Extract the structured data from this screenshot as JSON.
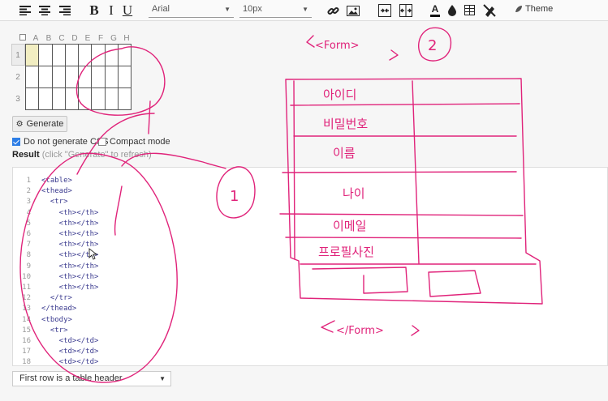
{
  "toolbar": {
    "font_family": "Arial",
    "font_size": "10px",
    "theme_label": "Theme",
    "icons": [
      "align-left-icon",
      "align-center-icon",
      "align-right-icon",
      "bold-icon",
      "italic-icon",
      "underline-icon",
      "link-icon",
      "image-icon",
      "merge-cells-icon",
      "split-cells-icon",
      "text-color-icon",
      "fill-color-icon",
      "table-border-icon",
      "clear-format-icon",
      "theme-icon"
    ],
    "bold_label": "B",
    "italic_label": "I",
    "underline_label": "U",
    "text_color_label": "A"
  },
  "grid": {
    "columns": [
      "A",
      "B",
      "C",
      "D",
      "E",
      "F",
      "G",
      "H"
    ],
    "rows": [
      "1",
      "2",
      "3"
    ],
    "highlight": "A1"
  },
  "actions": {
    "generate_label": "Generate",
    "no_css_label": "Do not generate CSS",
    "no_css_checked": true,
    "compact_label": "Compact mode",
    "compact_checked": false
  },
  "result": {
    "label": "Result",
    "note": "(click \"Generate\" to refresh)"
  },
  "code": {
    "lines": [
      "<table>",
      "<thead>",
      "  <tr>",
      "    <th></th>",
      "    <th></th>",
      "    <th></th>",
      "    <th></th>",
      "    <th></th>",
      "    <th></th>",
      "    <th></th>",
      "    <th></th>",
      "  </tr>",
      "</thead>",
      "<tbody>",
      "  <tr>",
      "    <td></td>",
      "    <td></td>",
      "    <td></td>"
    ]
  },
  "header_option": "First row is a table header",
  "annotations": {
    "label_top": "<Form>",
    "circle_num": "2",
    "circle_num_left": "1",
    "label_bottom": "</Form>",
    "rows": [
      "아이디",
      "비밀번호",
      "이름",
      "나이",
      "이메일",
      "프로필사진"
    ]
  },
  "colors": {
    "ink": "#e0237a",
    "grid_highlight": "#f2eec2",
    "checkbox": "#2d7ee6"
  }
}
